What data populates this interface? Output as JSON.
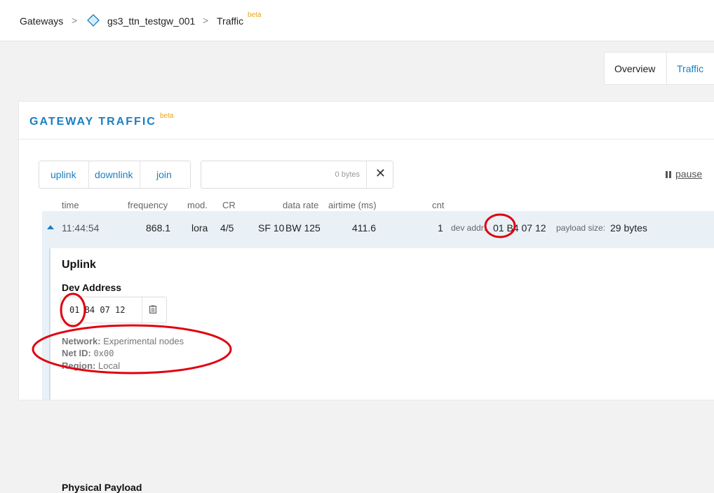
{
  "breadcrumb": {
    "items": [
      "Gateways",
      "gs3_ttn_testgw_001",
      "Traffic"
    ],
    "separator": ">",
    "beta": "beta"
  },
  "tabs": [
    "Overview",
    "Traffic"
  ],
  "card": {
    "title": "GATEWAY TRAFFIC",
    "beta": "beta"
  },
  "filters": [
    "uplink",
    "downlink",
    "join"
  ],
  "search": {
    "bytes": "0 bytes",
    "clear": "✕"
  },
  "pause_label": "pause",
  "columns": [
    "time",
    "frequency",
    "mod.",
    "CR",
    "data rate",
    "airtime (ms)",
    "cnt"
  ],
  "row": {
    "time": "11:44:54",
    "frequency": "868.1",
    "mod": "lora",
    "cr": "4/5",
    "sf": "SF 10",
    "bw": "BW 125",
    "airtime": "411.6",
    "cnt": "1",
    "dev_addr_label": "dev addr:",
    "dev_addr": "01 B4 07 12",
    "payload_label": "payload size:",
    "payload": "29 bytes"
  },
  "detail": {
    "heading": "Uplink",
    "dev_address_heading": "Dev Address",
    "dev_address_value": "01 B4 07 12",
    "network_label": "Network:",
    "network_value": "Experimental nodes",
    "netid_label": "Net ID:",
    "netid_value": "0x00",
    "region_label": "Region:",
    "region_value": "Local",
    "physical_payload_heading": "Physical Payload"
  },
  "icons": {
    "gateway": "gateway-icon",
    "copy": "copy-icon",
    "pause": "pause-icon",
    "close": "close-icon",
    "collapse": "caret-up-icon"
  },
  "colors": {
    "accent": "#1a7fc1",
    "beta": "#e8a317",
    "annotation": "#e0000f"
  }
}
